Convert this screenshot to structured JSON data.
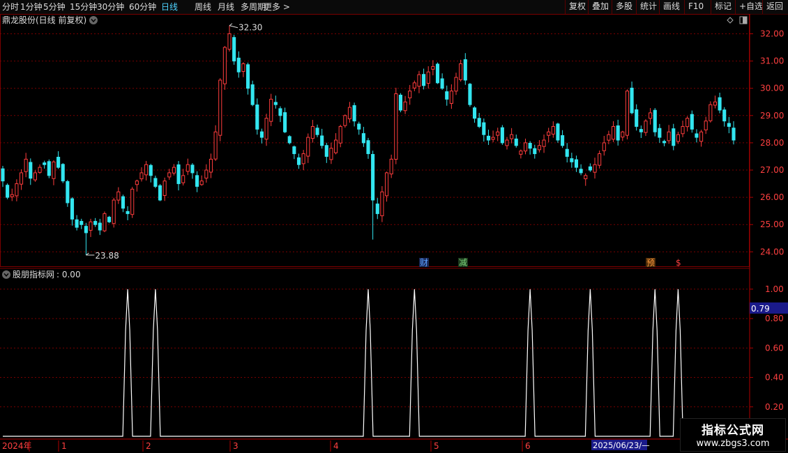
{
  "toolbar": {
    "left": [
      "分时",
      "1分钟",
      "5分钟",
      "15分钟",
      "30分钟",
      "60分钟",
      "日线",
      "周线",
      "月线",
      "多周期",
      "更多 >"
    ],
    "active_index": 6,
    "right": [
      "复权",
      "叠加",
      "多股",
      "统计",
      "画线",
      "F10",
      "标记",
      "+自选",
      "返回"
    ]
  },
  "main_panel": {
    "title": "鼎龙股份(日线 前复权)",
    "high_label": "32.30",
    "low_label": "23.88",
    "event_markers": [
      {
        "text": "财",
        "color": "#5aa0ff"
      },
      {
        "text": "减",
        "color": "#7cd67c"
      },
      {
        "text": "预",
        "color": "#ff9a3c"
      },
      {
        "text": "$",
        "color": "#ff4040"
      }
    ]
  },
  "indicator_panel": {
    "title": "股朋指标网",
    "value_text": ": 0.00",
    "cursor_value": "0.79"
  },
  "date_axis": {
    "labels": [
      "2024年",
      "1",
      "2",
      "3",
      "4",
      "5",
      "6"
    ],
    "cursor_date": "2025/06/23/—"
  },
  "watermark": {
    "line1": "指标公式网",
    "line2": "www.zbgs3.com"
  },
  "colors": {
    "up": "#ff3d3d",
    "down": "#33e6f0",
    "grid": "#7a0000",
    "axis": "#b00000",
    "text_axis": "#ff4040",
    "signal": "#ffffff"
  },
  "chart_data": [
    {
      "type": "candlestick",
      "title": "鼎龙股份(日线 前复权)",
      "ylim": [
        23.6,
        32.6
      ],
      "y_ticks": [
        24.0,
        25.0,
        26.0,
        27.0,
        28.0,
        29.0,
        30.0,
        31.0,
        32.0
      ],
      "high": 32.3,
      "low": 23.88,
      "close": [
        26.6,
        26.0,
        26.1,
        26.5,
        26.9,
        27.4,
        26.7,
        26.9,
        27.1,
        27.2,
        26.8,
        27.3,
        27.1,
        26.6,
        25.8,
        25.2,
        24.9,
        25.0,
        24.7,
        25.1,
        25.0,
        24.8,
        25.4,
        25.1,
        25.9,
        26.2,
        25.6,
        25.4,
        26.3,
        26.6,
        26.9,
        27.2,
        26.8,
        26.4,
        25.9,
        26.6,
        26.9,
        27.1,
        26.5,
        26.8,
        27.2,
        26.9,
        26.4,
        26.6,
        27.0,
        27.4,
        28.4,
        30.3,
        31.5,
        32.0,
        31.0,
        30.6,
        30.9,
        30.0,
        29.4,
        28.5,
        28.2,
        28.9,
        29.6,
        29.4,
        29.0,
        28.4,
        28.0,
        27.6,
        27.2,
        27.6,
        28.2,
        28.6,
        28.3,
        27.9,
        27.5,
        27.8,
        28.1,
        28.6,
        29.0,
        29.3,
        28.8,
        28.5,
        28.0,
        27.6,
        25.9,
        25.4,
        26.2,
        26.9,
        27.4,
        29.8,
        29.2,
        29.5,
        29.9,
        30.2,
        30.5,
        30.1,
        30.6,
        30.8,
        30.2,
        30.0,
        29.6,
        29.9,
        30.4,
        30.9,
        30.3,
        29.4,
        28.9,
        28.6,
        28.3,
        28.1,
        28.2,
        28.4,
        28.0,
        28.1,
        28.3,
        27.9,
        27.7,
        28.0,
        27.8,
        27.6,
        27.9,
        28.1,
        28.4,
        28.6,
        28.1,
        27.9,
        27.5,
        27.3,
        27.1,
        26.9,
        26.8,
        27.0,
        27.2,
        27.6,
        28.0,
        28.3,
        28.6,
        28.1,
        28.4,
        29.9,
        29.1,
        28.6,
        28.4,
        28.8,
        29.1,
        28.4,
        28.2,
        28.0,
        28.4,
        27.9,
        28.3,
        28.6,
        28.9,
        28.5,
        28.2,
        28.4,
        28.8,
        29.4,
        29.5,
        29.2,
        28.8,
        28.6,
        28.1
      ],
      "series": [
        {
          "name": "股朋指标网",
          "type": "line",
          "ylim": [
            0,
            1.08
          ],
          "y_ticks": [
            0.2,
            0.4,
            0.6,
            0.8,
            1.0
          ],
          "signal_value": 1.0,
          "signal_at_index": [
            27,
            33,
            79,
            89,
            114,
            127,
            141,
            146
          ]
        }
      ]
    }
  ]
}
